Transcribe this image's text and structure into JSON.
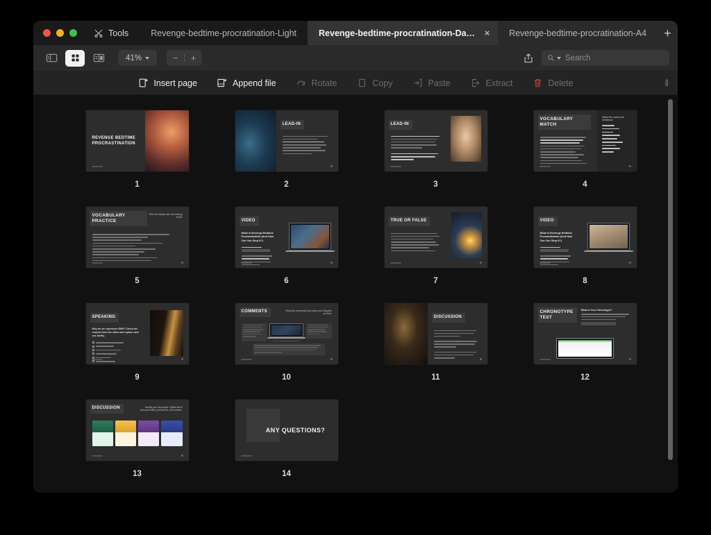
{
  "window": {
    "traffic_lights": [
      "close",
      "minimize",
      "zoom"
    ],
    "tools_label": "Tools",
    "tabs": [
      {
        "label": "Revenge-bedtime-procratination-Light",
        "active": false,
        "closable": false
      },
      {
        "label": "Revenge-bedtime-procratination-Da…",
        "active": true,
        "closable": true
      },
      {
        "label": "Revenge-bedtime-procratination-A4",
        "active": false,
        "closable": false
      }
    ],
    "new_tab_label": "+",
    "close_tab_label": "×"
  },
  "toolbar": {
    "view_modes": [
      {
        "name": "sidebar-view",
        "active": false
      },
      {
        "name": "grid-view",
        "active": true
      },
      {
        "name": "split-view",
        "active": false
      }
    ],
    "zoom_level": "41%",
    "zoom_out": "−",
    "zoom_in": "+",
    "share_icon": "share-icon",
    "search": {
      "placeholder": "Search",
      "value": ""
    }
  },
  "actions": [
    {
      "label": "Insert page",
      "icon": "insert-page-icon",
      "enabled": true
    },
    {
      "label": "Append file",
      "icon": "append-file-icon",
      "enabled": true
    },
    {
      "label": "Rotate",
      "icon": "rotate-icon",
      "enabled": false
    },
    {
      "label": "Copy",
      "icon": "copy-icon",
      "enabled": false
    },
    {
      "label": "Paste",
      "icon": "paste-icon",
      "enabled": false
    },
    {
      "label": "Extract",
      "icon": "extract-icon",
      "enabled": false
    },
    {
      "label": "Delete",
      "icon": "trash-icon",
      "enabled": false
    }
  ],
  "grip_label": "‖",
  "pages": [
    {
      "number": "1",
      "title": "REVENGE BEDTIME PROCRASTINATION",
      "layout": "title-right-photo"
    },
    {
      "number": "2",
      "title": "LEAD-IN",
      "layout": "photo-left-list-right"
    },
    {
      "number": "3",
      "title": "LEAD-IN",
      "layout": "text-left-photo-right"
    },
    {
      "number": "4",
      "title": "VOCABULARY MATCH",
      "layout": "two-column-list",
      "subtitle": "Match the words and definitions"
    },
    {
      "number": "5",
      "title": "VOCABULARY PRACTICE",
      "layout": "numbered-list",
      "subtitle": "Fill in the blanks with the missing words"
    },
    {
      "number": "6",
      "title": "VIDEO",
      "layout": "text-left-laptop-right",
      "subtitle": "What is Revenge Bedtime Procrastination (And How Can You Stop It?)"
    },
    {
      "number": "7",
      "title": "TRUE OR FALSE",
      "layout": "list-left-photo-right"
    },
    {
      "number": "8",
      "title": "VIDEO",
      "layout": "text-left-laptop-right",
      "subtitle": "What is Revenge Bedtime Procrastination (And How Can You Stop It?)"
    },
    {
      "number": "9",
      "title": "SPEAKING",
      "layout": "checklist-left-photo-right",
      "subtitle": "Why do we experience RBP? Check the reasons from the video and explain each one briefly."
    },
    {
      "number": "10",
      "title": "COMMENTS",
      "layout": "comment-cards",
      "subtitle": "Read the comments and share your thoughts on them"
    },
    {
      "number": "11",
      "title": "DISCUSSION",
      "layout": "photo-left-list-right"
    },
    {
      "number": "12",
      "title": "CHRONOTYPE TEST",
      "layout": "text-top-screenshot",
      "subtitle": "What Is Your Chronotype?"
    },
    {
      "number": "13",
      "title": "DISCUSSION",
      "layout": "card-grid",
      "subtitle": "Identify your chronotype. Speak about personal habits, preferences, and routines."
    },
    {
      "number": "14",
      "title": "ANY QUESTIONS?",
      "layout": "closing"
    }
  ],
  "colors": {
    "window_bg": "#1c1c1c",
    "tabbar_bg": "#2a2a2a",
    "active_tab_bg": "#343434",
    "content_bg": "#111111",
    "toolbar_bg": "#242424",
    "slide_bg": "#2d2d2d",
    "accent_delete": "#c0453f",
    "traffic_red": "#f1544a",
    "traffic_yellow": "#f5b01e",
    "traffic_green": "#3ec24c"
  }
}
